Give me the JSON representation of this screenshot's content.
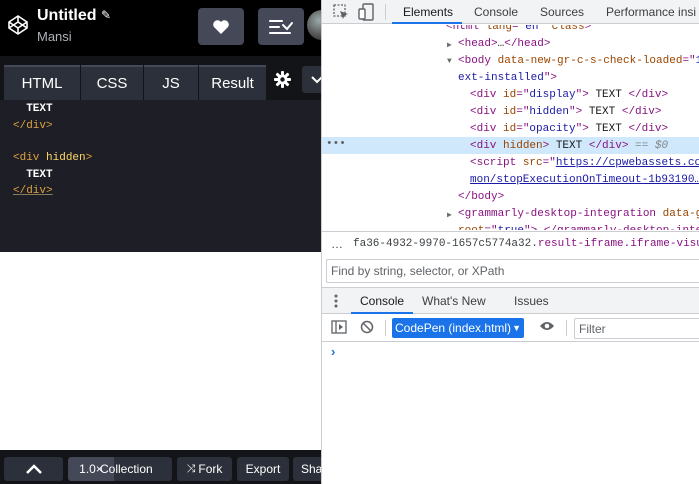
{
  "codepen": {
    "title": "Untitled",
    "pencil_glyph": "✎",
    "user": "Mansi",
    "tabs": [
      "HTML",
      "CSS",
      "JS",
      "Result"
    ],
    "code_lines": [
      {
        "text": "TEXT",
        "kind": "text",
        "indent": "  "
      },
      {
        "text": "</div>",
        "kind": "tag"
      },
      {
        "text": "",
        "kind": "blank"
      },
      {
        "text": "<div",
        "kind": "tag",
        "attr": "hidden",
        "close": ">"
      },
      {
        "text": "TEXT",
        "kind": "text",
        "indent": "  "
      },
      {
        "text": "</div>",
        "kind": "tagu"
      }
    ],
    "footer": {
      "zoom": "1.0×",
      "collection": "Collection",
      "fork": "Fork",
      "export": "Export",
      "share": "Share"
    },
    "icons": {
      "logo": "codepen-logo-icon",
      "heart": "heart-icon",
      "layout": "layout-icon",
      "gear": "gear-icon",
      "chevron": "chevron-down-icon",
      "up": "chevron-up-icon",
      "fork": "fork-icon"
    }
  },
  "devtools": {
    "tabs": [
      "Elements",
      "Console",
      "Sources",
      "Performance insi"
    ],
    "tree": [
      {
        "indent": 124,
        "tri": "",
        "parts": [
          [
            "tag",
            "<html "
          ],
          [
            "attr",
            "lang"
          ],
          [
            "tag",
            "=\""
          ],
          [
            "val",
            "en"
          ],
          [
            "tag",
            "\" "
          ],
          [
            "attr",
            "class"
          ],
          [
            "tag",
            "> "
          ]
        ]
      },
      {
        "indent": 136,
        "tri": "▶",
        "parts": [
          [
            "tag",
            "<head>"
          ],
          [
            "txt",
            "…"
          ],
          [
            "tag",
            "</head>"
          ]
        ]
      },
      {
        "indent": 136,
        "tri": "▼",
        "parts": [
          [
            "tag",
            "<body "
          ],
          [
            "attr",
            "data-new-gr-c-s-check-loaded"
          ],
          [
            "tag",
            "=\""
          ],
          [
            "val",
            "1"
          ]
        ]
      },
      {
        "indent": 136,
        "tri": "",
        "parts": [
          [
            "val",
            "ext-installed"
          ],
          [
            "tag",
            "\">"
          ]
        ]
      },
      {
        "indent": 148,
        "tri": "",
        "parts": [
          [
            "tag",
            "<div "
          ],
          [
            "attr",
            "id"
          ],
          [
            "tag",
            "=\""
          ],
          [
            "val",
            "display"
          ],
          [
            "tag",
            "\">"
          ],
          [
            "txt",
            " TEXT "
          ],
          [
            "tag",
            "</div>"
          ]
        ]
      },
      {
        "indent": 148,
        "tri": "",
        "parts": [
          [
            "tag",
            "<div "
          ],
          [
            "attr",
            "id"
          ],
          [
            "tag",
            "=\""
          ],
          [
            "val",
            "hidden"
          ],
          [
            "tag",
            "\">"
          ],
          [
            "txt",
            " TEXT "
          ],
          [
            "tag",
            "</div>"
          ]
        ]
      },
      {
        "indent": 148,
        "tri": "",
        "parts": [
          [
            "tag",
            "<div "
          ],
          [
            "attr",
            "id"
          ],
          [
            "tag",
            "=\""
          ],
          [
            "val",
            "opacity"
          ],
          [
            "tag",
            "\">"
          ],
          [
            "txt",
            " TEXT "
          ],
          [
            "tag",
            "</div>"
          ]
        ]
      },
      {
        "indent": 148,
        "tri": "",
        "parts": [
          [
            "tag",
            "<div "
          ],
          [
            "attr",
            "hidden"
          ],
          [
            "tag",
            ">"
          ],
          [
            "txt",
            " TEXT "
          ],
          [
            "tag",
            "</div>"
          ],
          [
            "dim",
            " == $0"
          ]
        ]
      },
      {
        "indent": 148,
        "tri": "",
        "parts": [
          [
            "tag",
            "<script "
          ],
          [
            "attr",
            "src"
          ],
          [
            "tag",
            "=\""
          ],
          [
            "link",
            "https://cpwebassets.co"
          ]
        ]
      },
      {
        "indent": 148,
        "tri": "",
        "parts": [
          [
            "link",
            "mon/stopExecutionOnTimeout-1b93190…"
          ]
        ]
      },
      {
        "indent": 136,
        "tri": "",
        "parts": [
          [
            "tag",
            "</body>"
          ]
        ]
      },
      {
        "indent": 136,
        "tri": "▶",
        "parts": [
          [
            "tag",
            "<grammarly-desktop-integration "
          ],
          [
            "attr",
            "data-g"
          ]
        ]
      },
      {
        "indent": 136,
        "tri": "",
        "parts": [
          [
            "attr",
            "root"
          ],
          [
            "tag",
            "=\""
          ],
          [
            "val",
            "true"
          ],
          [
            "tag",
            "\"> </grammarly-desktop-inte"
          ]
        ]
      }
    ],
    "breadcrumb_prefix": "fa36-4932-9970-1657c5774a32.",
    "breadcrumb_highlight": "result-iframe.iframe-visual-update",
    "find_placeholder": "Find by string, selector, or XPath",
    "drawer_tabs": [
      "Console",
      "What's New",
      "Issues"
    ],
    "context": "CodePen (index.html)",
    "filter_placeholder": "Filter",
    "prompt": "›"
  }
}
